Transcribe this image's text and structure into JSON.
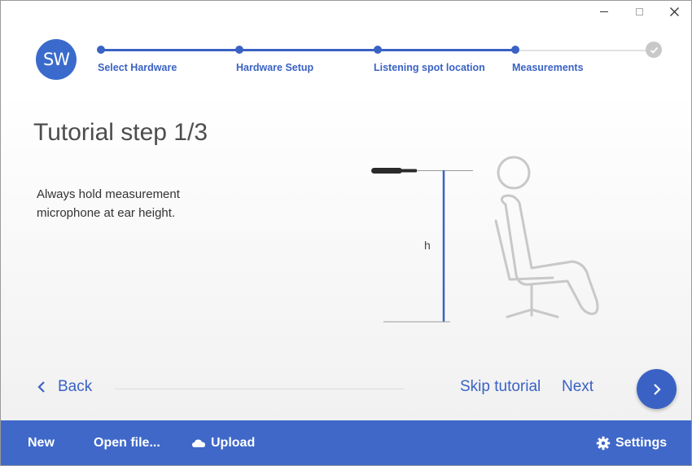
{
  "window": {
    "controls": {
      "minimize": "minimize-icon",
      "maximize": "maximize-icon",
      "close": "close-icon"
    }
  },
  "logo": {
    "text": "SW"
  },
  "stepper": {
    "steps": [
      {
        "label": "Select Hardware"
      },
      {
        "label": "Hardware Setup"
      },
      {
        "label": "Listening spot location"
      },
      {
        "label": "Measurements"
      }
    ],
    "final_icon": "check-icon"
  },
  "main": {
    "title": "Tutorial step 1/3",
    "description": "Always hold measurement microphone at ear height.",
    "illustration": {
      "height_label": "h"
    }
  },
  "nav": {
    "back_label": "Back",
    "skip_label": "Skip tutorial",
    "next_label": "Next"
  },
  "footer": {
    "new_label": "New",
    "open_label": "Open file...",
    "upload_label": "Upload",
    "settings_label": "Settings"
  },
  "colors": {
    "accent": "#3a62c4",
    "footer_bg": "#3f68c9",
    "text": "#333333"
  }
}
